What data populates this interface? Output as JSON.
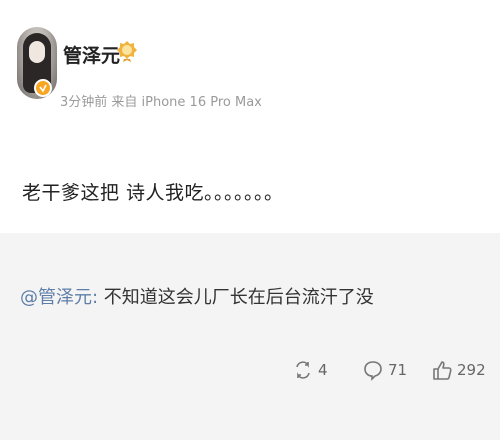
{
  "user": {
    "name": "管泽元",
    "meta": "3分钟前 来自 iPhone 16 Pro Max"
  },
  "post": {
    "text": "老干爹这把 诗人我吃。。。。。。。"
  },
  "repost": {
    "mention": "@管泽元:",
    "text": " 不知道这会儿厂长在后台流汗了没"
  },
  "actions": {
    "repost_count": "4",
    "comment_count": "71",
    "like_count": "292"
  },
  "colors": {
    "mention": "#5e7ea8",
    "badge": "#f6a623",
    "repost_bg": "#f4f4f4"
  },
  "icons": [
    "verified-icon",
    "medal-icon",
    "repost-icon",
    "comment-icon",
    "like-icon"
  ]
}
